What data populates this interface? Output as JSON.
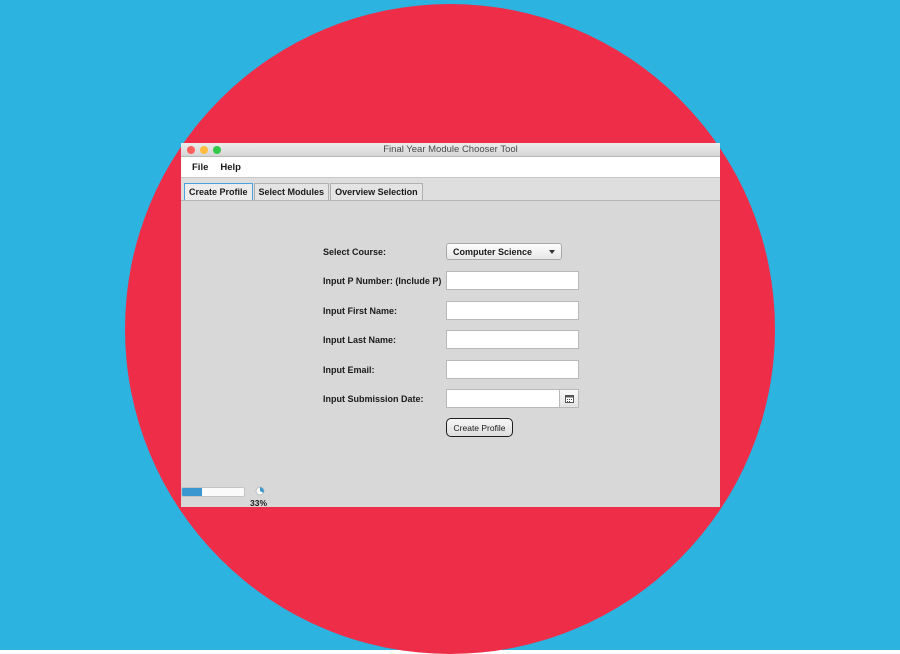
{
  "colors": {
    "background": "#2cb3df",
    "circle": "#ee2d49",
    "window_bg": "#d8d8d8",
    "close": "#fc605c",
    "minimize": "#fdbc40",
    "maximize": "#34c84a",
    "accent": "#3a97d0"
  },
  "window": {
    "title": "Final Year Module Chooser Tool"
  },
  "menu": {
    "items": [
      {
        "label": "File"
      },
      {
        "label": "Help"
      }
    ]
  },
  "tabs": [
    {
      "label": "Create Profile",
      "active": true
    },
    {
      "label": "Select Modules",
      "active": false
    },
    {
      "label": "Overview Selection",
      "active": false
    }
  ],
  "form": {
    "course_label": "Select Course:",
    "course_value": "Computer Science",
    "pnumber_label": "Input P Number: (Include P)",
    "pnumber_value": "",
    "firstname_label": "Input First Name:",
    "firstname_value": "",
    "lastname_label": "Input Last Name:",
    "lastname_value": "",
    "email_label": "Input Email:",
    "email_value": "",
    "date_label": "Input Submission Date:",
    "date_value": "",
    "date_icon": "calendar-icon",
    "submit_label": "Create Profile"
  },
  "progress": {
    "percent": 33,
    "text": "33%"
  }
}
